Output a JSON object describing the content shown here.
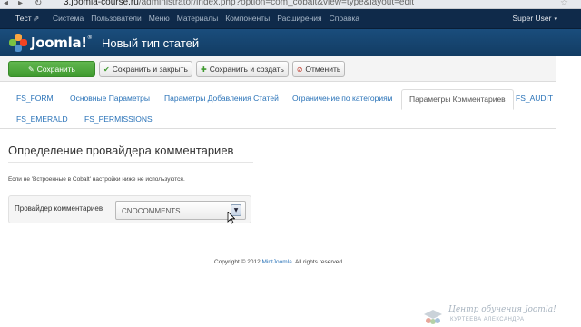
{
  "browser": {
    "url_host": "3.joomla-course.ru",
    "url_path": "/administrator/index.php?option=com_cobalt&view=type&layout=edit",
    "back_icon": "arrow-left-icon",
    "forward_icon": "arrow-right-icon",
    "reload_icon": "reload-icon",
    "star_icon": "star-icon"
  },
  "topnav": {
    "site": "Тест",
    "site_icon": "external-link-icon",
    "menu": [
      "Система",
      "Пользователи",
      "Меню",
      "Материалы",
      "Компоненты",
      "Расширения",
      "Справка"
    ],
    "user": "Super User",
    "user_caret": "▾"
  },
  "header": {
    "logo_text": "Joomla!",
    "logo_tm": "®",
    "title": "Новый тип статей"
  },
  "toolbar": {
    "save": "Сохранить",
    "save_close": "Сохранить и закрыть",
    "save_new": "Сохранить и создать",
    "cancel": "Отменить"
  },
  "tabs": {
    "fs_form": "FS_FORM",
    "basic": "Основные Параметры",
    "add": "Параметры Добавления Статей",
    "restrict": "Ограничение по категориям",
    "comments": "Параметры Комментариев",
    "fs_audit": "FS_AUDIT",
    "fs_emerald": "FS_EMERALD",
    "fs_permissions": "FS_PERMISSIONS",
    "active": "comments"
  },
  "content": {
    "section_title": "Определение провайдера комментариев",
    "note": "Если не 'Встроенные в Cobalt' настройки ниже не используются.",
    "field_label": "Провайдер комментариев",
    "select_value": "CNOCOMMENTS"
  },
  "footer": {
    "prefix": "Copyright © 2012",
    "link": "MintJoomla",
    "suffix": ". All rights reserved"
  },
  "watermark": {
    "title": "Центр обучения Joomla!",
    "subtitle": "КУРТЕЕВА АЛЕКСАНДРА"
  },
  "colors": {
    "nav_bg": "#0f2a4a",
    "header_bg": "#1a4d7c",
    "save_green": "#4fa83d",
    "link_blue": "#2a73b8"
  }
}
